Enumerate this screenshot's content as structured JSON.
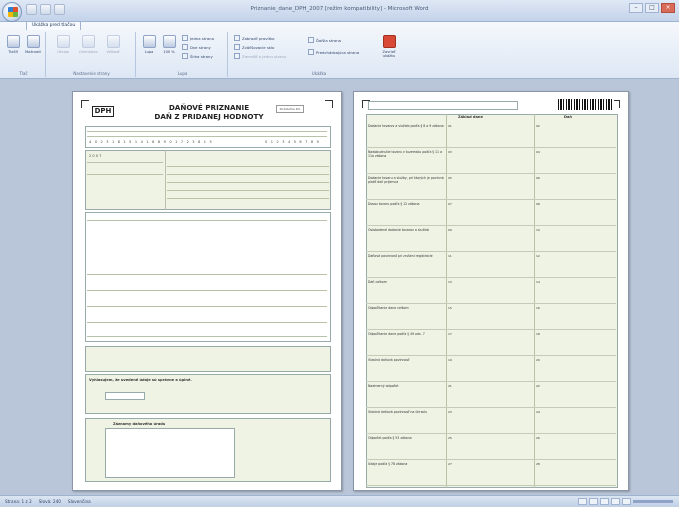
{
  "window": {
    "title": "Priznanie_dane_DPH_2007 [režim kompatibility] - Microsoft Word"
  },
  "ribbon": {
    "active_tab": "Ukážka pred tlačou",
    "groups": {
      "print": {
        "label": "Tlač",
        "print_label": "Tlačiť",
        "options_label": "Možnosti"
      },
      "page_setup": {
        "label": "Nastavenie strany",
        "margins_label": "Okraje",
        "orientation_label": "Orientácia",
        "size_label": "Veľkosť"
      },
      "zoom": {
        "label": "Lupa",
        "zoom_label": "Lupa",
        "percent_label": "100 %",
        "one_page": "Jedna strana",
        "two_pages": "Dve strany",
        "page_width": "Šírka strany"
      },
      "preview": {
        "label": "Ukážka",
        "show_ruler": "Zobraziť pravítko",
        "magnifier": "Zväčšovacie sklo",
        "shrink": "Zmenšiť o jednu stranu",
        "next_page": "Ďalšia strana",
        "prev_page": "Predchádzajúca strana",
        "close_preview": "Zavrieť ukážku"
      }
    }
  },
  "page1": {
    "dph": "DPH",
    "title_line1": "DAŇOVÉ PRIZNANIE",
    "title_line2": "DAŇ Z PRIDANEJ HODNOTY",
    "stamp": "Podateľňa DÚ",
    "tin_digits": "4 0 2 3 1 8 1 5 1 4 1 6 8 9 0 1 7 2 3 8 1 5",
    "tin_digits2": "0 1 2 3 4 5 6 7 8 9",
    "tax_year": "2007",
    "section_declaration": "Vyhlasujem, že uvedené údaje sú správne a úplné.",
    "section_notes": "Záznamy daňového úradu"
  },
  "page2": {
    "section_header_left": "Základ dane",
    "section_header_right": "Daň",
    "rows": [
      "Dodanie tovarov a služieb podľa § 8 a 9 zákona",
      "Nadobudnutie tovaru v tuzemsku podľa § 11 a 11a zákona",
      "Dodanie tovaru a služby, pri ktorých je povinná platiť daň príjemca",
      "Dovoz tovaru podľa § 12 zákona",
      "Oslobodené dodanie tovarov a služieb",
      "Daňová povinnosť pri zrušení registrácie",
      "Daň celkom",
      "Odpočítanie dane celkom",
      "Odpočítanie dane podľa § 49 ods. 7",
      "Vlastná daňová povinnosť",
      "Nadmerný odpočet",
      "Vlastná daňová povinnosť na úhradu",
      "Odpočet podľa § 53 zákona",
      "Údaje podľa § 78 zákona"
    ]
  },
  "statusbar": {
    "page_info": "Strana: 1 z 2",
    "words": "Slová: 240",
    "language": "Slovenčina"
  }
}
